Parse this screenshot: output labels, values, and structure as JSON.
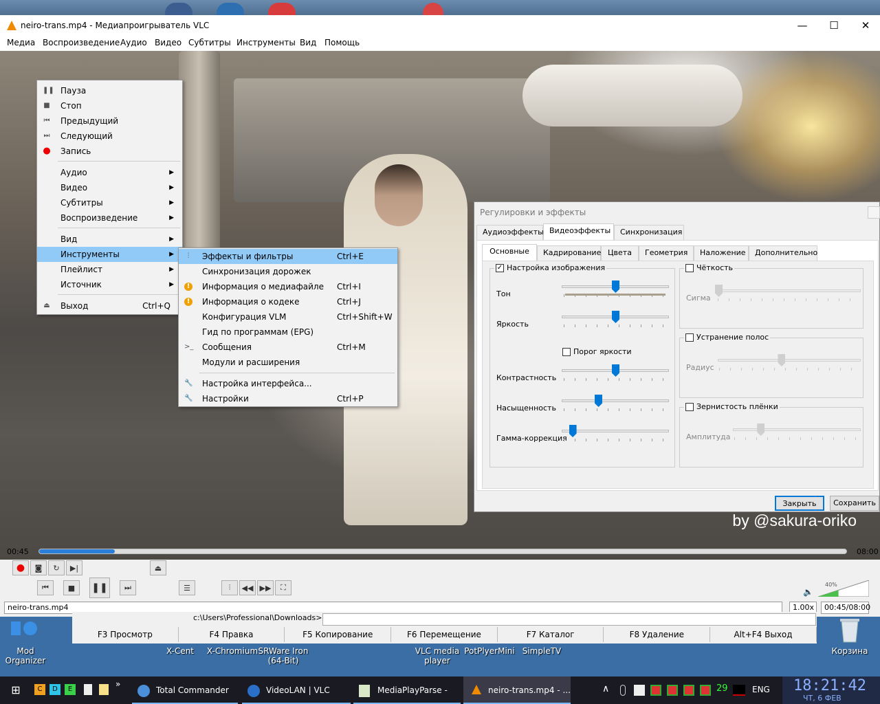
{
  "window": {
    "title": "neiro-trans.mp4 - Медиапроигрыватель VLC",
    "minimize": "—",
    "maximize": "☐",
    "close": "✕"
  },
  "menubar": [
    "Медиа",
    "Воспроизведение",
    "Аудио",
    "Видео",
    "Субтитры",
    "Инструменты",
    "Вид",
    "Помощь"
  ],
  "watermark": "by @sakura-oriko",
  "context_menu": {
    "items": [
      {
        "label": "Пауза",
        "icon": "pause-icon",
        "glyph": "❚❚"
      },
      {
        "label": "Стоп",
        "icon": "stop-icon",
        "glyph": "■"
      },
      {
        "label": "Предыдущий",
        "icon": "previous-icon",
        "glyph": "⏮"
      },
      {
        "label": "Следующий",
        "icon": "next-icon",
        "glyph": "⏭"
      },
      {
        "label": "Запись",
        "icon": "record-icon",
        "glyph": "●"
      },
      {
        "label": "Аудио",
        "arrow": "▶"
      },
      {
        "label": "Видео",
        "arrow": "▶"
      },
      {
        "label": "Субтитры",
        "arrow": "▶"
      },
      {
        "label": "Воспроизведение",
        "arrow": "▶"
      },
      {
        "label": "Вид",
        "arrow": "▶"
      },
      {
        "label": "Инструменты",
        "arrow": "▶"
      },
      {
        "label": "Плейлист",
        "arrow": "▶"
      },
      {
        "label": "Источник",
        "arrow": "▶"
      },
      {
        "label": "Выход",
        "shortcut": "Ctrl+Q",
        "icon": "exit-icon",
        "glyph": "⏏"
      }
    ]
  },
  "tools_submenu": {
    "items": [
      {
        "label": "Эффекты и фильтры",
        "shortcut": "Ctrl+E",
        "icon": "equalizer-icon",
        "glyph": "⫶"
      },
      {
        "label": "Синхронизация дорожек",
        "shortcut": ""
      },
      {
        "label": "Информация о медиафайле",
        "shortcut": "Ctrl+I",
        "icon": "info-icon",
        "glyph": "!"
      },
      {
        "label": "Информация о кодеке",
        "shortcut": "Ctrl+J",
        "icon": "info-icon",
        "glyph": "!"
      },
      {
        "label": "Конфигурация VLM",
        "shortcut": "Ctrl+Shift+W"
      },
      {
        "label": "Гид по программам (EPG)",
        "shortcut": ""
      },
      {
        "label": "Сообщения",
        "shortcut": "Ctrl+M",
        "icon": "terminal-icon",
        "glyph": ">_"
      },
      {
        "label": "Модули и расширения",
        "shortcut": ""
      },
      {
        "label": "Настройка интерфейса...",
        "shortcut": "",
        "icon": "wrench-icon",
        "glyph": "🔧"
      },
      {
        "label": "Настройки",
        "shortcut": "Ctrl+P",
        "icon": "wrench-icon",
        "glyph": "🔧"
      }
    ]
  },
  "effects_dialog": {
    "title": "Регулировки и эффекты",
    "tabs": [
      "Аудиоэффекты",
      "Видеоэффекты",
      "Синхронизация"
    ],
    "subtabs": [
      "Основные",
      "Кадрирование",
      "Цвета",
      "Геометрия",
      "Наложение",
      "Дополнительно"
    ],
    "image_adjust": {
      "label": "Настройка изображения",
      "checked": "✓",
      "sliders": [
        {
          "label": "Тон",
          "value": 0.5
        },
        {
          "label": "Яркость",
          "value": 0.5
        },
        {
          "label": "Контрастность",
          "value": 0.5
        },
        {
          "label": "Насыщенность",
          "value": 0.34
        },
        {
          "label": "Гамма-коррекция",
          "value": 0.1
        }
      ],
      "threshold": "Порог яркости"
    },
    "sharpen": {
      "label": "Чёткость",
      "slider": "Сигма",
      "value": 0.0
    },
    "banding": {
      "label": "Устранение полос",
      "slider": "Радиус",
      "value": 0.43
    },
    "grain": {
      "label": "Зернистость плёнки",
      "slider": "Амплитуда",
      "value": 0.2
    },
    "close": "Закрыть",
    "save": "Сохранить"
  },
  "player": {
    "elapsed": "00:45",
    "total": "08:00",
    "progress": 0.094,
    "status_file": "neiro-trans.mp4",
    "speed": "1.00x",
    "time_display": "00:45/08:00",
    "volume": "40%",
    "volume_level": 0.4
  },
  "total_commander": {
    "path": "c:\\Users\\Professional\\Downloads>",
    "fkeys": [
      "F3 Просмотр",
      "F4 Правка",
      "F5 Копирование",
      "F6 Перемещение",
      "F7 Каталог",
      "F8 Удаление",
      "Alt+F4 Выход"
    ]
  },
  "desktop_icons": [
    "Mod Organizer",
    "X-Cent",
    "X-Chromium",
    "SRWare Iron (64-Bit)",
    "VLC media player",
    "PotPlyerMini",
    "SimpleTV",
    "Корзина"
  ],
  "taskbar": {
    "quick": [
      "C",
      "D",
      "E"
    ],
    "more": "»",
    "apps": [
      "Total Commander ...",
      "VideoLAN | VLC me...",
      "MediaPlayParse - Y...",
      "neiro-trans.mp4 - ..."
    ],
    "tray_num": "29",
    "lang": "ENG",
    "time": "18:21:42",
    "date": "ЧТ, 6 ФЕВ"
  }
}
